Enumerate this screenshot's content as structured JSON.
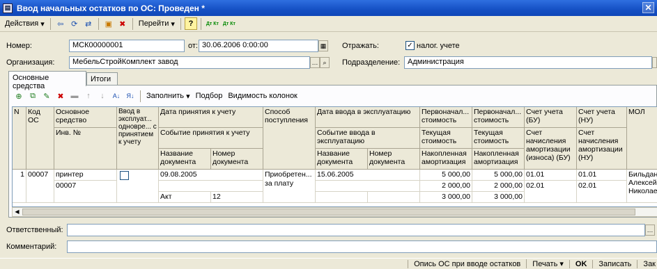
{
  "window": {
    "title": "Ввод начальных остатков по ОС: Проведен *",
    "close": "✕"
  },
  "toolbar": {
    "actions": "Действия",
    "goto": "Перейти",
    "help": "?",
    "dt_kt": "Дт Кт",
    "dt_kt_n": "Дт Кт"
  },
  "form": {
    "number_label": "Номер:",
    "number_value": "МСК00000001",
    "date_label": "от:",
    "date_value": "30.06.2006  0:00:00",
    "reflect_label": "Отражать:",
    "tax_check_label": "налог. учете",
    "org_label": "Организация:",
    "org_value": "МебельСтройКомплект завод",
    "dept_label": "Подразделение:",
    "dept_value": "Администрация",
    "resp_label": "Ответственный:",
    "resp_value": "",
    "comment_label": "Комментарий:",
    "comment_value": ""
  },
  "tabs": [
    "Основные средства",
    "Итоги"
  ],
  "grid_toolbar": {
    "fill": "Заполнить",
    "select": "Подбор",
    "columns": "Видимость колонок"
  },
  "grid": {
    "headers": {
      "n": "N",
      "code": "Код ОС",
      "asset": "Основное средство",
      "inv": "Инв. №",
      "inop": "Ввод в эксплуат... одновре... с принятием к учету",
      "accept_date": "Дата принятия к учету",
      "accept_event": "Событие принятия к учету",
      "doc_name": "Название документа",
      "doc_num": "Номер документа",
      "method": "Способ поступления",
      "input_date": "Дата ввода в эксплуатацию",
      "input_event": "Событие ввода в эксплуатацию",
      "doc_name2": "Название документа",
      "doc_num2": "Номер документа",
      "init_cost_bu": "Первоначал... стоимость",
      "cur_cost_bu": "Текущая стоимость",
      "accum_bu": "Накопленная амортизация",
      "init_cost_nu": "Первоначал... стоимость",
      "cur_cost_nu": "Текущая стоимость",
      "accum_nu": "Накопленная амортизация",
      "acc_bu": "Счет учета (БУ)",
      "acc_am_bu": "Счет начисления амортизации (износа) (БУ)",
      "acc_nu": "Счет учета (НУ)",
      "acc_am_nu": "Счет начисления амортизации (НУ)",
      "mol": "МОЛ"
    },
    "row": {
      "n": "1",
      "code": "00007",
      "asset": "принтер",
      "inv": "00007",
      "accept_date": "09.08.2005",
      "doc_name": "Акт",
      "doc_num": "12",
      "method": "Приобретен... за плату",
      "input_date": "15.06.2005",
      "init_bu": "5 000,00",
      "cur_bu": "2 000,00",
      "acc_bu_val": "3 000,00",
      "init_nu": "5 000,00",
      "cur_nu": "2 000,00",
      "acc_nu_val": "3 000,00",
      "acc_bu": "01.01",
      "acc_am_bu": "02.01",
      "acc_nu": "01.01",
      "acc_am_nu": "02.01",
      "mol1": "Бильдан...",
      "mol2": "Алексей...",
      "mol3": "Николае..."
    }
  },
  "status": {
    "desc": "Опись ОС при вводе остатков",
    "print": "Печать",
    "ok": "OK",
    "save": "Записать",
    "close": "Зак"
  }
}
